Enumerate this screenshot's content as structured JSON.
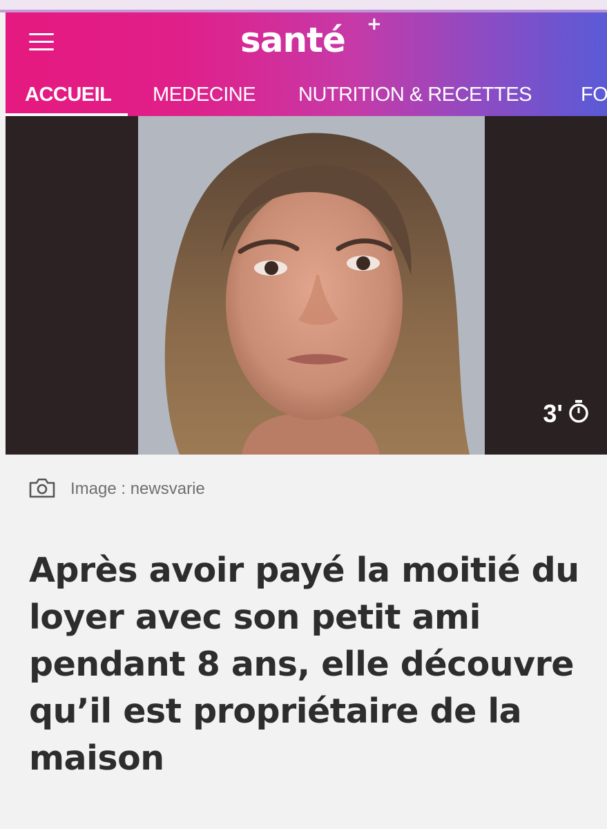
{
  "site": {
    "logo_text": "santé",
    "logo_plus": "+"
  },
  "nav": {
    "items": [
      {
        "label": "ACCUEIL",
        "active": true
      },
      {
        "label": "MEDECINE",
        "active": false
      },
      {
        "label": "NUTRITION & RECETTES",
        "active": false
      },
      {
        "label": "FO",
        "active": false
      }
    ]
  },
  "hero": {
    "read_time": "3'",
    "read_time_icon": "stopwatch-icon"
  },
  "caption": {
    "icon": "camera-icon",
    "text": "Image : newsvarie"
  },
  "article": {
    "headline": "Après avoir payé la moitié du loyer avec son petit ami pendant 8 ans, elle découvre qu’il est propriétaire de la maison"
  },
  "colors": {
    "header_gradient_start": "#e5197f",
    "header_gradient_end": "#5a5ad6",
    "headline_text": "#2d2d2d",
    "caption_text": "#6f6f6f"
  }
}
